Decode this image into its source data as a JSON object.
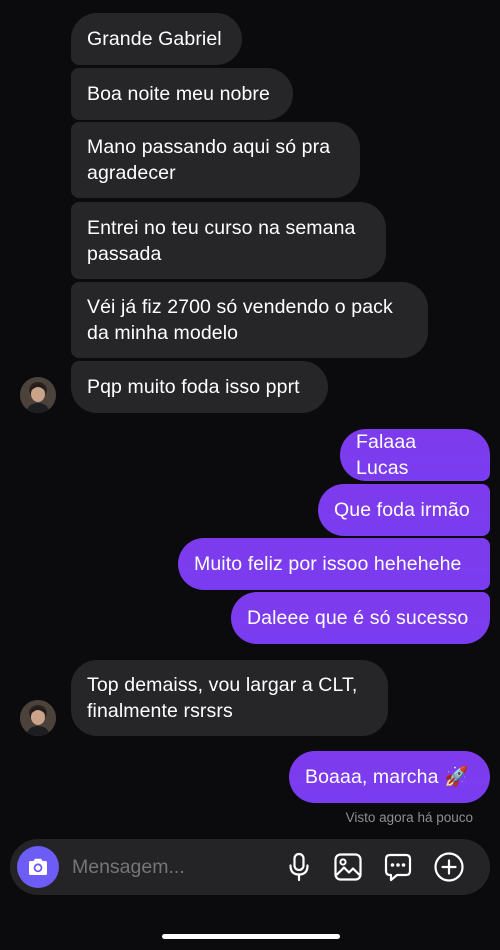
{
  "colors": {
    "background": "#0b0b0d",
    "incoming_bubble": "#262629",
    "outgoing_bubble": "#7c3aed",
    "camera_button": "#6d5cf5",
    "muted_text": "#8e8e93"
  },
  "incoming": [
    {
      "text": "Grande Gabriel"
    },
    {
      "text": "Boa noite meu nobre"
    },
    {
      "text": "Mano passando aqui só pra\nagradecer"
    },
    {
      "text": "Entrei no teu curso na semana\npassada"
    },
    {
      "text": "Véi já fiz 2700 só vendendo o pack\nda minha modelo"
    },
    {
      "text": "Pqp muito foda isso pprt"
    }
  ],
  "outgoing": [
    {
      "text": "Falaaa Lucas"
    },
    {
      "text": "Que foda irmão"
    },
    {
      "text": "Muito feliz por issoo hehehehe"
    },
    {
      "text": "Daleee que é só sucesso"
    }
  ],
  "incoming_2": [
    {
      "text": "Top demaiss, vou largar a CLT,\nfinalmente rsrsrs"
    }
  ],
  "outgoing_2": [
    {
      "text": "Boaaa, marcha 🚀"
    }
  ],
  "seen_status": "Visto agora há pouco",
  "composer": {
    "placeholder": "Mensagem...",
    "icons": [
      "camera-icon",
      "microphone-icon",
      "gallery-icon",
      "sticker-icon",
      "plus-icon"
    ]
  }
}
